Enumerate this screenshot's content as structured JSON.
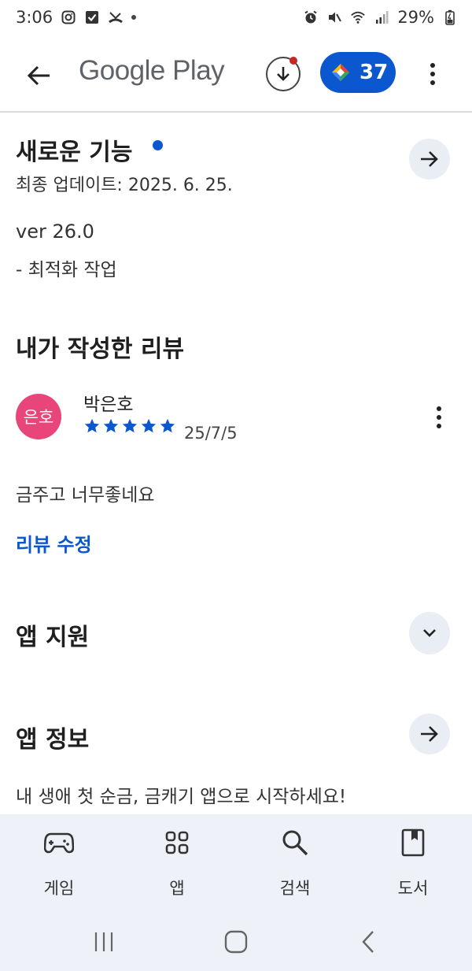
{
  "status_bar": {
    "time": "3:06",
    "battery": "29%"
  },
  "app_bar": {
    "title": "Google Play",
    "points": "37"
  },
  "whats_new": {
    "title": "새로운 기능",
    "updated": "최종 업데이트: 2025. 6. 25.",
    "version": "ver 26.0",
    "note": "- 최적화 작업"
  },
  "my_review": {
    "title": "내가 작성한 리뷰",
    "avatar_text": "은호",
    "reviewer": "박은호",
    "stars": 5,
    "date": "25/7/5",
    "text": "금주고 너무좋네요",
    "edit_label": "리뷰 수정"
  },
  "app_support": {
    "title": "앱 지원"
  },
  "app_info": {
    "title": "앱 정보",
    "description": "내 생애 첫 순금, 금캐기 앱으로 시작하세요!"
  },
  "bottom_nav": {
    "items": [
      {
        "label": "게임",
        "icon": "gamepad-icon"
      },
      {
        "label": "앱",
        "icon": "apps-grid-icon"
      },
      {
        "label": "검색",
        "icon": "search-icon"
      },
      {
        "label": "도서",
        "icon": "book-icon"
      }
    ]
  },
  "colors": {
    "accent": "#0b57d0",
    "avatar": "#e8457a",
    "nav_background": "#eef2f8"
  }
}
